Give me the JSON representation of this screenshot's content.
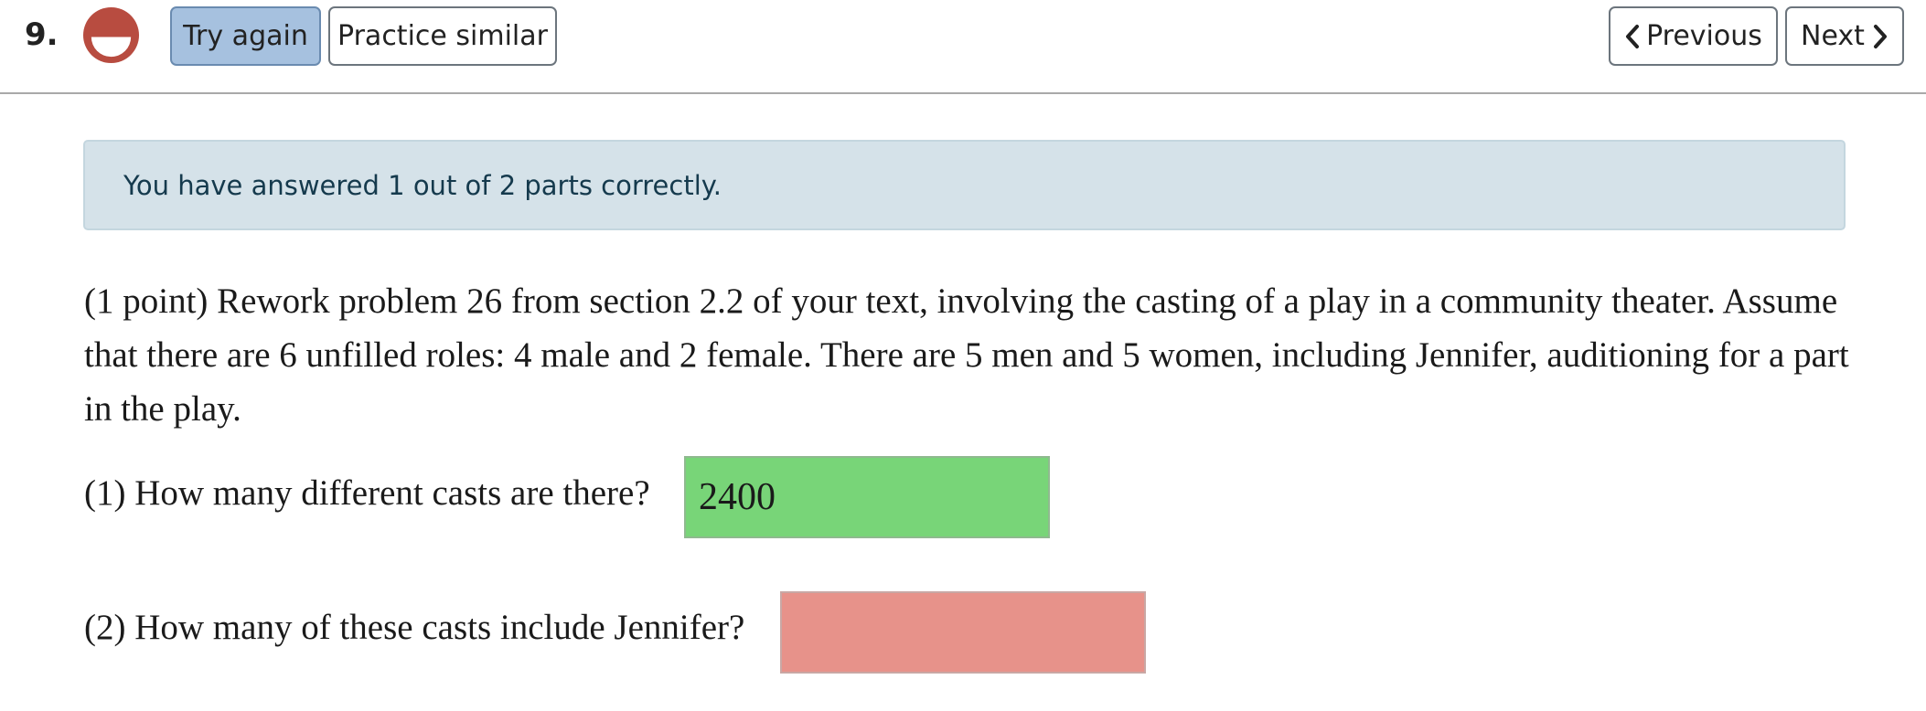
{
  "header": {
    "question_number": "9.",
    "score_icon": "half-correct-icon",
    "try_again_label": "Try again",
    "practice_similar_label": "Practice similar",
    "previous_label": "Previous",
    "next_label": "Next"
  },
  "status": {
    "message": "You have answered 1 out of 2 parts correctly."
  },
  "problem": {
    "text": "(1 point) Rework problem 26 from section 2.2 of your text, involving the casting of a play in a community theater. Assume that there are 6 unfilled roles: 4 male and 2 female. There are 5 men and 5 women, including Jennifer, auditioning for a part in the play.",
    "parts": [
      {
        "label": "(1) How many different casts are there?",
        "value": "2400",
        "state": "correct"
      },
      {
        "label": "(2) How many of these casts include Jennifer?",
        "value": "",
        "state": "incorrect"
      }
    ]
  },
  "colors": {
    "correct": "#78d578",
    "incorrect": "#e7928a",
    "score_icon": "#b84c40",
    "alert_bg": "#d5e2e9",
    "active_button": "#a6c1df"
  }
}
